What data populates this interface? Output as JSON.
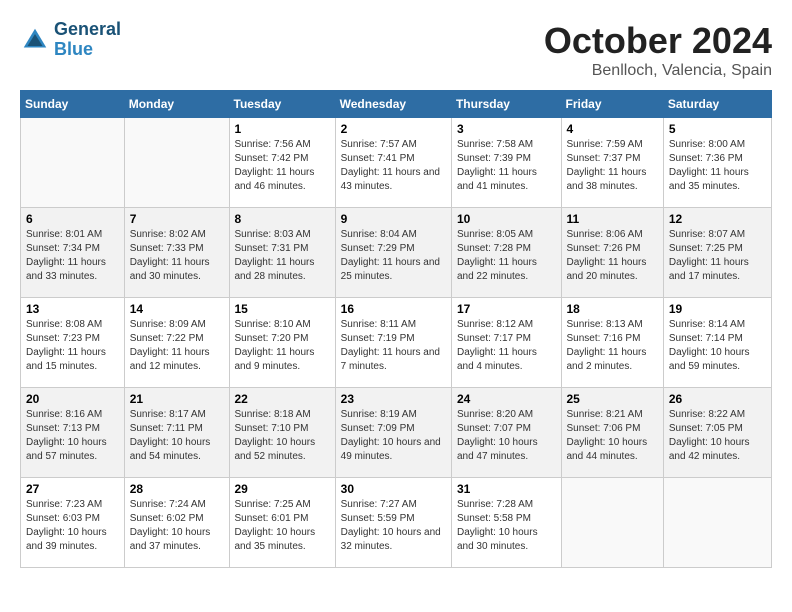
{
  "logo": {
    "line1": "General",
    "line2": "Blue"
  },
  "title": "October 2024",
  "subtitle": "Benlloch, Valencia, Spain",
  "days_of_week": [
    "Sunday",
    "Monday",
    "Tuesday",
    "Wednesday",
    "Thursday",
    "Friday",
    "Saturday"
  ],
  "weeks": [
    [
      {
        "day": "",
        "sunrise": "",
        "sunset": "",
        "daylight": "",
        "empty": true
      },
      {
        "day": "",
        "sunrise": "",
        "sunset": "",
        "daylight": "",
        "empty": true
      },
      {
        "day": "1",
        "sunrise": "Sunrise: 7:56 AM",
        "sunset": "Sunset: 7:42 PM",
        "daylight": "Daylight: 11 hours and 46 minutes."
      },
      {
        "day": "2",
        "sunrise": "Sunrise: 7:57 AM",
        "sunset": "Sunset: 7:41 PM",
        "daylight": "Daylight: 11 hours and 43 minutes."
      },
      {
        "day": "3",
        "sunrise": "Sunrise: 7:58 AM",
        "sunset": "Sunset: 7:39 PM",
        "daylight": "Daylight: 11 hours and 41 minutes."
      },
      {
        "day": "4",
        "sunrise": "Sunrise: 7:59 AM",
        "sunset": "Sunset: 7:37 PM",
        "daylight": "Daylight: 11 hours and 38 minutes."
      },
      {
        "day": "5",
        "sunrise": "Sunrise: 8:00 AM",
        "sunset": "Sunset: 7:36 PM",
        "daylight": "Daylight: 11 hours and 35 minutes."
      }
    ],
    [
      {
        "day": "6",
        "sunrise": "Sunrise: 8:01 AM",
        "sunset": "Sunset: 7:34 PM",
        "daylight": "Daylight: 11 hours and 33 minutes."
      },
      {
        "day": "7",
        "sunrise": "Sunrise: 8:02 AM",
        "sunset": "Sunset: 7:33 PM",
        "daylight": "Daylight: 11 hours and 30 minutes."
      },
      {
        "day": "8",
        "sunrise": "Sunrise: 8:03 AM",
        "sunset": "Sunset: 7:31 PM",
        "daylight": "Daylight: 11 hours and 28 minutes."
      },
      {
        "day": "9",
        "sunrise": "Sunrise: 8:04 AM",
        "sunset": "Sunset: 7:29 PM",
        "daylight": "Daylight: 11 hours and 25 minutes."
      },
      {
        "day": "10",
        "sunrise": "Sunrise: 8:05 AM",
        "sunset": "Sunset: 7:28 PM",
        "daylight": "Daylight: 11 hours and 22 minutes."
      },
      {
        "day": "11",
        "sunrise": "Sunrise: 8:06 AM",
        "sunset": "Sunset: 7:26 PM",
        "daylight": "Daylight: 11 hours and 20 minutes."
      },
      {
        "day": "12",
        "sunrise": "Sunrise: 8:07 AM",
        "sunset": "Sunset: 7:25 PM",
        "daylight": "Daylight: 11 hours and 17 minutes."
      }
    ],
    [
      {
        "day": "13",
        "sunrise": "Sunrise: 8:08 AM",
        "sunset": "Sunset: 7:23 PM",
        "daylight": "Daylight: 11 hours and 15 minutes."
      },
      {
        "day": "14",
        "sunrise": "Sunrise: 8:09 AM",
        "sunset": "Sunset: 7:22 PM",
        "daylight": "Daylight: 11 hours and 12 minutes."
      },
      {
        "day": "15",
        "sunrise": "Sunrise: 8:10 AM",
        "sunset": "Sunset: 7:20 PM",
        "daylight": "Daylight: 11 hours and 9 minutes."
      },
      {
        "day": "16",
        "sunrise": "Sunrise: 8:11 AM",
        "sunset": "Sunset: 7:19 PM",
        "daylight": "Daylight: 11 hours and 7 minutes."
      },
      {
        "day": "17",
        "sunrise": "Sunrise: 8:12 AM",
        "sunset": "Sunset: 7:17 PM",
        "daylight": "Daylight: 11 hours and 4 minutes."
      },
      {
        "day": "18",
        "sunrise": "Sunrise: 8:13 AM",
        "sunset": "Sunset: 7:16 PM",
        "daylight": "Daylight: 11 hours and 2 minutes."
      },
      {
        "day": "19",
        "sunrise": "Sunrise: 8:14 AM",
        "sunset": "Sunset: 7:14 PM",
        "daylight": "Daylight: 10 hours and 59 minutes."
      }
    ],
    [
      {
        "day": "20",
        "sunrise": "Sunrise: 8:16 AM",
        "sunset": "Sunset: 7:13 PM",
        "daylight": "Daylight: 10 hours and 57 minutes."
      },
      {
        "day": "21",
        "sunrise": "Sunrise: 8:17 AM",
        "sunset": "Sunset: 7:11 PM",
        "daylight": "Daylight: 10 hours and 54 minutes."
      },
      {
        "day": "22",
        "sunrise": "Sunrise: 8:18 AM",
        "sunset": "Sunset: 7:10 PM",
        "daylight": "Daylight: 10 hours and 52 minutes."
      },
      {
        "day": "23",
        "sunrise": "Sunrise: 8:19 AM",
        "sunset": "Sunset: 7:09 PM",
        "daylight": "Daylight: 10 hours and 49 minutes."
      },
      {
        "day": "24",
        "sunrise": "Sunrise: 8:20 AM",
        "sunset": "Sunset: 7:07 PM",
        "daylight": "Daylight: 10 hours and 47 minutes."
      },
      {
        "day": "25",
        "sunrise": "Sunrise: 8:21 AM",
        "sunset": "Sunset: 7:06 PM",
        "daylight": "Daylight: 10 hours and 44 minutes."
      },
      {
        "day": "26",
        "sunrise": "Sunrise: 8:22 AM",
        "sunset": "Sunset: 7:05 PM",
        "daylight": "Daylight: 10 hours and 42 minutes."
      }
    ],
    [
      {
        "day": "27",
        "sunrise": "Sunrise: 7:23 AM",
        "sunset": "Sunset: 6:03 PM",
        "daylight": "Daylight: 10 hours and 39 minutes."
      },
      {
        "day": "28",
        "sunrise": "Sunrise: 7:24 AM",
        "sunset": "Sunset: 6:02 PM",
        "daylight": "Daylight: 10 hours and 37 minutes."
      },
      {
        "day": "29",
        "sunrise": "Sunrise: 7:25 AM",
        "sunset": "Sunset: 6:01 PM",
        "daylight": "Daylight: 10 hours and 35 minutes."
      },
      {
        "day": "30",
        "sunrise": "Sunrise: 7:27 AM",
        "sunset": "Sunset: 5:59 PM",
        "daylight": "Daylight: 10 hours and 32 minutes."
      },
      {
        "day": "31",
        "sunrise": "Sunrise: 7:28 AM",
        "sunset": "Sunset: 5:58 PM",
        "daylight": "Daylight: 10 hours and 30 minutes."
      },
      {
        "day": "",
        "sunrise": "",
        "sunset": "",
        "daylight": "",
        "empty": true
      },
      {
        "day": "",
        "sunrise": "",
        "sunset": "",
        "daylight": "",
        "empty": true
      }
    ]
  ]
}
